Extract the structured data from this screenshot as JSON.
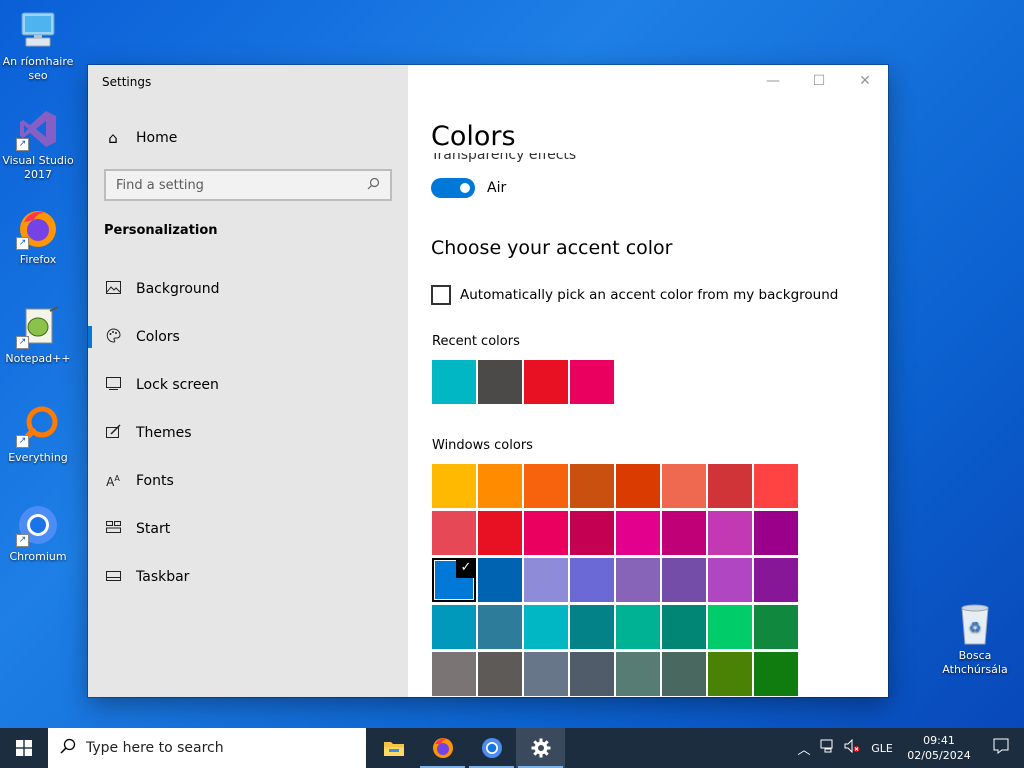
{
  "desktop": {
    "icons": [
      {
        "label": "An ríomhaire seo",
        "icon": "computer-icon"
      },
      {
        "label": "Visual Studio 2017",
        "icon": "visual-studio-icon"
      },
      {
        "label": "Firefox",
        "icon": "firefox-icon"
      },
      {
        "label": "Notepad++",
        "icon": "notepad-plus-plus-icon"
      },
      {
        "label": "Everything",
        "icon": "everything-search-icon"
      },
      {
        "label": "Chromium",
        "icon": "chromium-icon"
      },
      {
        "label": "Bosca Athchúrsála",
        "icon": "recycle-bin-icon"
      }
    ]
  },
  "window": {
    "title": "Settings",
    "caption_buttons": [
      "minimize",
      "maximize",
      "close"
    ],
    "sidebar": {
      "home_label": "Home",
      "search_placeholder": "Find a setting",
      "section_title": "Personalization",
      "items": [
        {
          "label": "Background",
          "icon": "picture-icon"
        },
        {
          "label": "Colors",
          "icon": "palette-icon",
          "active": true
        },
        {
          "label": "Lock screen",
          "icon": "lock-screen-icon"
        },
        {
          "label": "Themes",
          "icon": "brush-icon"
        },
        {
          "label": "Fonts",
          "icon": "font-icon"
        },
        {
          "label": "Start",
          "icon": "start-menu-icon"
        },
        {
          "label": "Taskbar",
          "icon": "taskbar-icon"
        }
      ]
    },
    "content": {
      "page_title": "Colors",
      "transparency_label": "Transparency effects",
      "transparency_state": "Air",
      "transparency_on": true,
      "accent_heading": "Choose your accent color",
      "auto_pick_label": "Automatically pick an accent color from my background",
      "auto_pick_checked": false,
      "recent_label": "Recent colors",
      "recent_colors": [
        "#00b7c3",
        "#4c4a48",
        "#e81123",
        "#ea005e"
      ],
      "windows_label": "Windows colors",
      "windows_colors": [
        "#ffb900",
        "#ff8c00",
        "#f7630c",
        "#ca5010",
        "#da3b01",
        "#ef6950",
        "#d13438",
        "#ff4343",
        "#e74856",
        "#e81123",
        "#ea005e",
        "#c30052",
        "#e3008c",
        "#bf0077",
        "#c239b3",
        "#9a0089",
        "#0078d7",
        "#0063b1",
        "#8e8cd8",
        "#6b69d6",
        "#8764b8",
        "#744da9",
        "#b146c2",
        "#881798",
        "#0099bc",
        "#2d7d9a",
        "#00b7c3",
        "#038387",
        "#00b294",
        "#018574",
        "#00cc6a",
        "#10893e",
        "#7a7574",
        "#5d5a58",
        "#68768a",
        "#515c6b",
        "#567c73",
        "#486860",
        "#498205",
        "#107c10"
      ],
      "selected_color_index": 16
    }
  },
  "taskbar": {
    "search_placeholder": "Type here to search",
    "apps": [
      {
        "name": "file-explorer-icon"
      },
      {
        "name": "firefox-icon"
      },
      {
        "name": "chromium-icon"
      },
      {
        "name": "settings-gear-icon"
      }
    ],
    "language": "GLE",
    "time": "09:41",
    "date": "02/05/2024"
  }
}
